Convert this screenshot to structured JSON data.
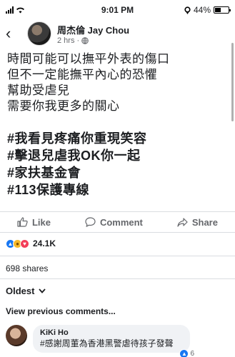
{
  "status_bar": {
    "time": "9:01 PM",
    "battery": "44%",
    "battery_level": 0.44
  },
  "header": {
    "name": "周杰倫 Jay Chou",
    "subtitle": "2 hrs ·",
    "back_icon": "chevron-left-icon",
    "privacy_icon": "globe-icon"
  },
  "post": {
    "lines": [
      "時間可能可以撫平外表的傷口",
      "但不一定能撫平內心的恐懼",
      "幫助受虐兒",
      "需要你我更多的關心"
    ],
    "hashtags": [
      "#我看見疼痛你重現笑容",
      "#擊退兒虐我OK你一起",
      "#家扶基金會",
      "#113保護專線"
    ]
  },
  "actions": {
    "like": "Like",
    "comment": "Comment",
    "share": "Share"
  },
  "reactions": {
    "count": "24.1K"
  },
  "shares": "698 shares",
  "sort": {
    "label": "Oldest"
  },
  "view_previous": "View previous comments...",
  "comment": {
    "name": "KiKi Ho",
    "text": "#感謝周董為香港黑警虐待孩子發聲",
    "reaction_count": "6"
  }
}
